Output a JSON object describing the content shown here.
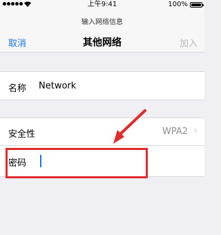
{
  "status_bar": {
    "time": "上午9:41",
    "battery_pct": "100%",
    "wifi_icon": "wifi-icon",
    "signal_icon": "signal-dots-icon",
    "battery_icon": "battery-icon"
  },
  "nav": {
    "prompt": "输入网络信息",
    "cancel_label": "取消",
    "title": "其他网络",
    "join_label": "加入"
  },
  "form": {
    "name_label": "名称",
    "name_value": "Network",
    "security_label": "安全性",
    "security_value": "WPA2",
    "password_label": "密码",
    "password_value": ""
  },
  "annotation": {
    "color": "#e02b2b",
    "arrow_icon": "red-arrow-icon"
  },
  "colors": {
    "accent": "#1a73e8",
    "background": "#efeff4",
    "disabled": "#b9b9be"
  }
}
